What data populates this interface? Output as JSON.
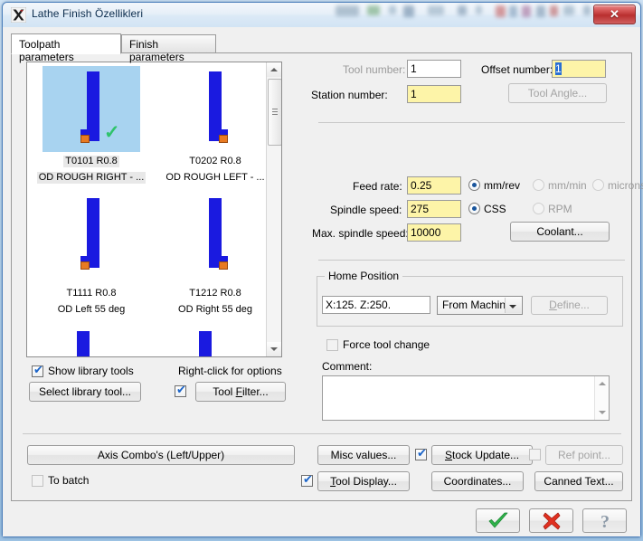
{
  "window": {
    "title": "Lathe Finish Özellikleri",
    "icon": "mastercam-icon",
    "close_label": "✕"
  },
  "tabs": [
    {
      "label": "Toolpath parameters",
      "active": true
    },
    {
      "label": "Finish parameters",
      "active": false
    }
  ],
  "tool_list": {
    "tools": [
      {
        "id": "T0101 R0.8",
        "desc": "OD ROUGH RIGHT - ...",
        "selected": true,
        "orientation": "right"
      },
      {
        "id": "T0202 R0.8",
        "desc": "OD ROUGH LEFT - ...",
        "selected": false,
        "orientation": "left"
      },
      {
        "id": "T1111 R0.8",
        "desc": "OD Left 55 deg",
        "selected": false,
        "orientation": "right"
      },
      {
        "id": "T1212 R0.8",
        "desc": "OD Right 55 deg",
        "selected": false,
        "orientation": "left"
      }
    ],
    "scroll_up": "▲",
    "scroll_down": "▼"
  },
  "tool_options": {
    "show_library_tools_label": "Show library tools",
    "show_library_tools_checked": true,
    "right_click_hint": "Right-click for options",
    "select_library_tool_label": "Select library tool...",
    "tool_filter_checked": true,
    "tool_filter_label": "Tool Filter..."
  },
  "tool_info": {
    "tool_number_label": "Tool number:",
    "tool_number_value": "1",
    "tool_number_disabled": true,
    "offset_number_label": "Offset number:",
    "offset_number_value": "1",
    "station_number_label": "Station number:",
    "station_number_value": "1",
    "tool_angle_label": "Tool Angle...",
    "tool_angle_disabled": true
  },
  "speeds": {
    "feed_rate_label": "Feed rate:",
    "feed_rate_value": "0.25",
    "feed_units": [
      {
        "label": "mm/rev",
        "selected": true,
        "disabled": false
      },
      {
        "label": "mm/min",
        "selected": false,
        "disabled": true
      },
      {
        "label": "microns",
        "selected": false,
        "disabled": true
      }
    ],
    "spindle_speed_label": "Spindle speed:",
    "spindle_speed_value": "275",
    "spindle_modes": [
      {
        "label": "CSS",
        "selected": true,
        "disabled": false
      },
      {
        "label": "RPM",
        "selected": false,
        "disabled": true
      }
    ],
    "max_spindle_label": "Max. spindle speed:",
    "max_spindle_value": "10000",
    "coolant_label": "Coolant..."
  },
  "home_position": {
    "group_title": "Home Position",
    "value": "X:125.  Z:250.",
    "source_selected": "From Machine",
    "define_label": "Define...",
    "define_disabled": true,
    "force_tool_change_label": "Force tool change",
    "force_tool_change_checked": false,
    "force_tool_change_disabled": true
  },
  "comment": {
    "label": "Comment:",
    "value": ""
  },
  "bottom": {
    "axis_combo_label": "Axis Combo's (Left/Upper)",
    "to_batch_label": "To batch",
    "to_batch_checked": false,
    "to_batch_disabled": true,
    "misc_values_label": "Misc values...",
    "tool_display_label": "Tool Display...",
    "tool_display_checked": true,
    "stock_update_label": "Stock Update...",
    "stock_update_checked": true,
    "coordinates_label": "Coordinates...",
    "ref_point_label": "Ref point...",
    "ref_point_checked": false,
    "ref_point_disabled": true,
    "canned_text_label": "Canned Text..."
  },
  "actions": {
    "ok_icon": "check-icon",
    "cancel_icon": "cross-icon",
    "help_icon": "question-icon"
  },
  "colors": {
    "field_yellow": "#fdf4a8",
    "tool_blue": "#1a1ae0",
    "tool_tip_orange": "#e87a22",
    "selection_blue": "#a8d3f0",
    "ok_green": "#2fb34a",
    "cancel_red": "#e03020",
    "titlebar_blue": "#0b2c4d"
  }
}
